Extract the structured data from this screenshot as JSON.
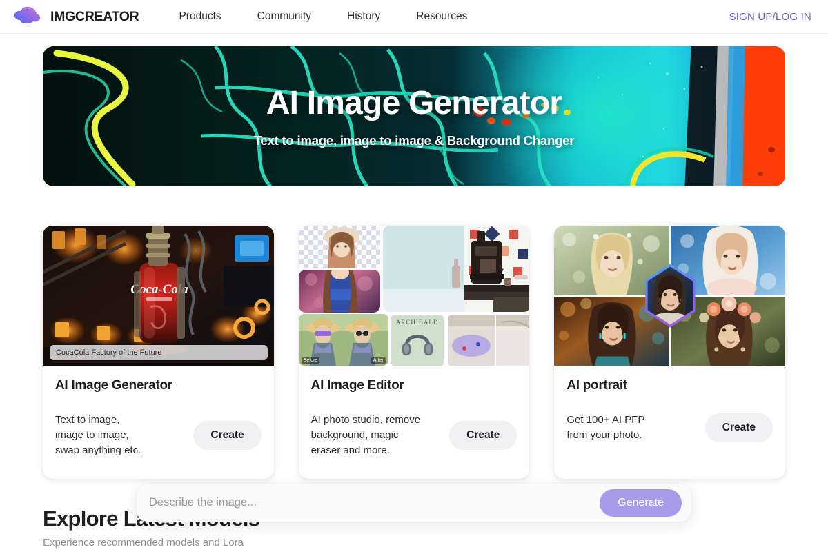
{
  "header": {
    "brand_name": "IMGCREATOR",
    "logo_icon": "gradient-blob-logo-icon",
    "nav": [
      {
        "label": "Products"
      },
      {
        "label": "Community"
      },
      {
        "label": "History"
      },
      {
        "label": "Resources"
      }
    ],
    "auth_label": "SIGN UP/LOG IN",
    "auth_color": "#6c63c7"
  },
  "hero": {
    "title": "AI Image Generator",
    "subtitle": "Text to image, image to image & Background Changer",
    "art_description": "abstract fluid-art marbling, black cells with cyan and yellow veins, orange on right"
  },
  "cards": [
    {
      "title": "AI Image Generator",
      "description": "Text to image,\nimage to image,\nswap anything etc.",
      "button_label": "Create",
      "media_caption": "CocaCola Factory of the Future"
    },
    {
      "title": "AI Image Editor",
      "description": "AI photo studio, remove\nbackground, magic\neraser and more.",
      "button_label": "Create",
      "media_labels": {
        "before": "Before",
        "after": "After",
        "product": "ARCHIBALD"
      }
    },
    {
      "title": "AI portrait",
      "description": "Get 100+ AI PFP\nfrom your photo.",
      "button_label": "Create"
    }
  ],
  "prompt": {
    "placeholder": "Describe the image...",
    "value": "",
    "generate_label": "Generate",
    "generate_color": "#a79ae8"
  },
  "explore": {
    "title": "Explore Latest Models",
    "subtitle": "Experience recommended models and Lora"
  }
}
